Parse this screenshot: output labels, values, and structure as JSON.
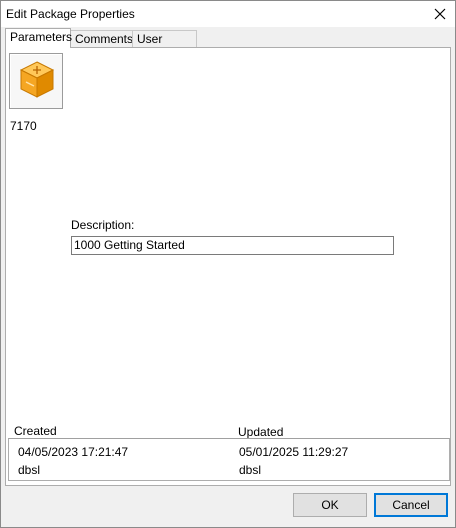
{
  "window": {
    "title": "Edit Package Properties"
  },
  "tabs": [
    {
      "label": "Parameters",
      "active": true
    },
    {
      "label": "Comments",
      "active": false
    },
    {
      "label": "User Fields",
      "active": false
    }
  ],
  "package": {
    "icon": "package-box-icon",
    "id": "7170"
  },
  "description": {
    "label": "Description:",
    "value": "1000 Getting Started"
  },
  "created": {
    "label": "Created",
    "date": "04/05/2023 17:21:47",
    "user": "dbsl"
  },
  "updated": {
    "label": "Updated",
    "date": "05/01/2025 11:29:27",
    "user": "dbsl"
  },
  "buttons": {
    "ok": "OK",
    "cancel": "Cancel"
  },
  "colors": {
    "accent": "#0078d7",
    "icon_orange": "#f5a623",
    "button_face": "#e1e1e1"
  }
}
